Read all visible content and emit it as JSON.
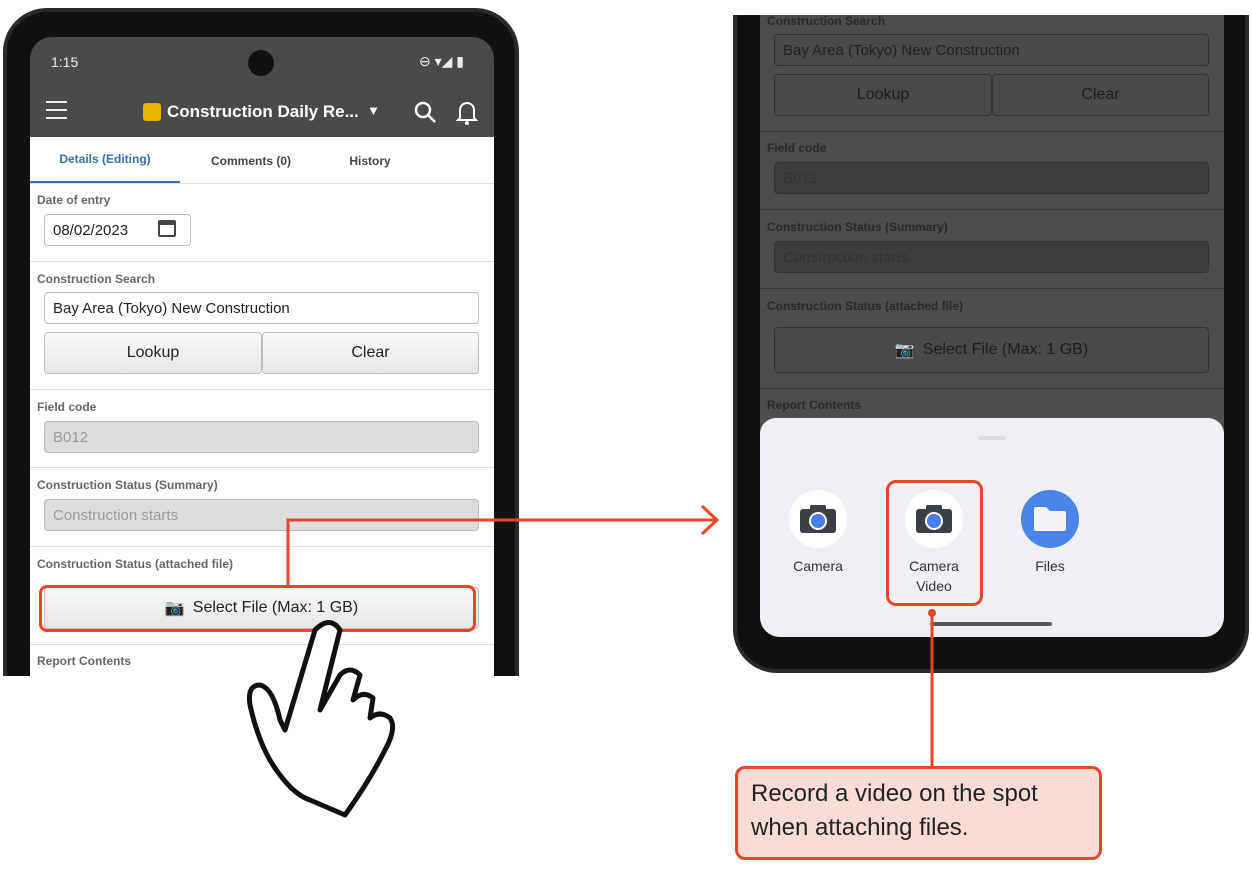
{
  "left_phone": {
    "status": {
      "time": "1:15"
    },
    "header": {
      "title": "Construction Daily Re..."
    },
    "tabs": [
      {
        "label": "Details (Editing)",
        "active": true
      },
      {
        "label": "Comments (0)"
      },
      {
        "label": "History"
      }
    ],
    "fields": {
      "date_label": "Date of entry",
      "date_value": "08/02/2023",
      "search_label": "Construction Search",
      "search_value": "Bay Area (Tokyo) New Construction",
      "lookup": "Lookup",
      "clear": "Clear",
      "field_code_label": "Field code",
      "field_code_value": "B012",
      "status_summary_label": "Construction Status (Summary)",
      "status_summary_value": "Construction starts",
      "attached_label": "Construction Status (attached file)",
      "select_file": "Select File (Max: 1 GB)",
      "report_label": "Report Contents"
    }
  },
  "right_phone": {
    "fields": {
      "search_label": "Construction Search",
      "search_value": "Bay Area (Tokyo) New Construction",
      "lookup": "Lookup",
      "clear": "Clear",
      "field_code_label": "Field code",
      "field_code_value": "B012",
      "status_summary_label": "Construction Status (Summary)",
      "status_summary_value": "Construction starts",
      "attached_label": "Construction Status (attached file)",
      "select_file": "Select File (Max: 1 GB)",
      "report_label": "Report Contents"
    },
    "sheet": {
      "apps": [
        {
          "label": "Camera",
          "icon": "camera-icon"
        },
        {
          "label": "Camera",
          "sublabel": "Video",
          "icon": "camera-icon"
        },
        {
          "label": "Files",
          "icon": "folder-icon"
        }
      ]
    }
  },
  "callout": {
    "text": "Record a video on the spot when attaching files."
  },
  "colors": {
    "accent": "#e8432b",
    "callout_bg": "#f9dcd8",
    "tab_active": "#3a6ea5",
    "header_bg": "#4a4a4a"
  }
}
